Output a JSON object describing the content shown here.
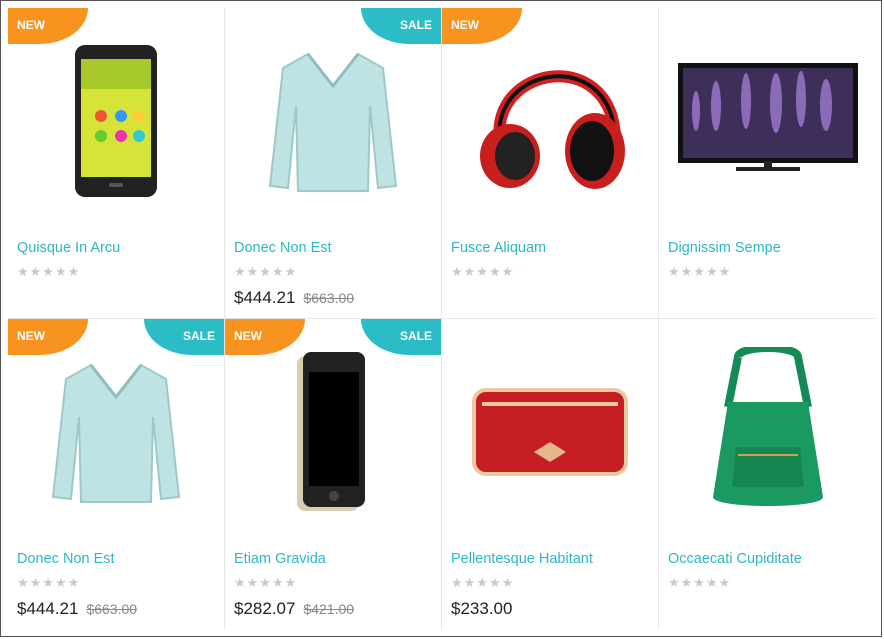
{
  "colors": {
    "new_badge": "#f7931e",
    "sale_badge": "#2bbcc5",
    "product_name": "#2bb8c4",
    "star": "#c9c9c9"
  },
  "products": [
    {
      "name": "Quisque In Arcu",
      "badge_new": "NEW",
      "badge_sale": "",
      "price": "",
      "old_price": "",
      "image": "phone-icon",
      "stars": "★★★★★"
    },
    {
      "name": "Donec Non Est",
      "badge_new": "",
      "badge_sale": "SALE",
      "price": "$444.21",
      "old_price": "$663.00",
      "image": "sweater-icon",
      "stars": "★★★★★"
    },
    {
      "name": "Fusce Aliquam",
      "badge_new": "NEW",
      "badge_sale": "",
      "price": "",
      "old_price": "",
      "image": "headphones-icon",
      "stars": "★★★★★"
    },
    {
      "name": "Dignissim Sempe",
      "badge_new": "",
      "badge_sale": "",
      "price": "",
      "old_price": "",
      "image": "tv-icon",
      "stars": "★★★★★"
    },
    {
      "name": "Donec Non Est",
      "badge_new": "NEW",
      "badge_sale": "SALE",
      "price": "$444.21",
      "old_price": "$663.00",
      "image": "sweater-icon",
      "stars": "★★★★★"
    },
    {
      "name": "Etiam Gravida",
      "badge_new": "NEW",
      "badge_sale": "SALE",
      "price": "$282.07",
      "old_price": "$421.00",
      "image": "phone-case-icon",
      "stars": "★★★★★"
    },
    {
      "name": "Pellentesque Habitant",
      "badge_new": "",
      "badge_sale": "",
      "price": "$233.00",
      "old_price": "",
      "image": "pouch-icon",
      "stars": "★★★★★"
    },
    {
      "name": "Occaecati Cupiditate",
      "badge_new": "",
      "badge_sale": "",
      "price": "",
      "old_price": "",
      "image": "backpack-icon",
      "stars": "★★★★★"
    }
  ]
}
